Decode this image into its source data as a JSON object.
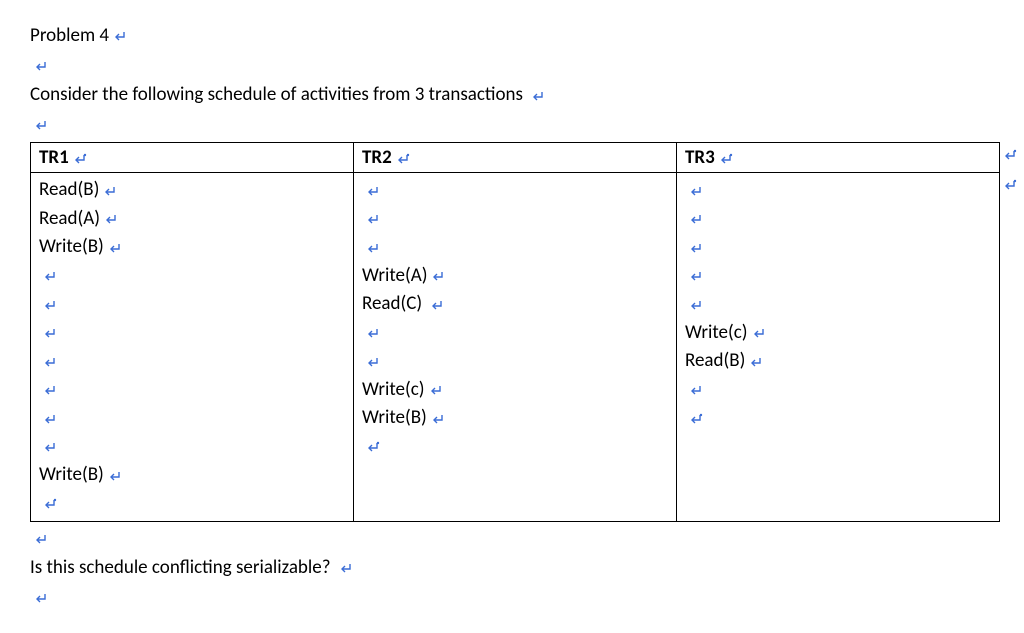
{
  "heading": "Problem 4",
  "intro": "Consider the following schedule of activities from 3 transactions ",
  "question": "Is this schedule conflicting serializable? ",
  "table": {
    "headers": [
      "TR1",
      "TR2",
      "TR3"
    ],
    "rows": [
      {
        "c1": "Read(B)",
        "c2": "",
        "c3": ""
      },
      {
        "c1": "Read(A)",
        "c2": "",
        "c3": ""
      },
      {
        "c1": "Write(B)",
        "c2": "",
        "c3": ""
      },
      {
        "c1": "",
        "c2": "Write(A)",
        "c3": ""
      },
      {
        "c1": "",
        "c2": "Read(C) ",
        "c3": ""
      },
      {
        "c1": "",
        "c2": "",
        "c3": "Write(c)"
      },
      {
        "c1": "",
        "c2": "",
        "c3": "Read(B)"
      },
      {
        "c1": "",
        "c2": "Write(c)",
        "c3": ""
      },
      {
        "c1": "",
        "c2": "Write(B)",
        "c3": ""
      },
      {
        "c1": "",
        "c2": "",
        "c3": null
      },
      {
        "c1": "Write(B)",
        "c2": null,
        "c3": null
      },
      {
        "c1": "",
        "c2": null,
        "c3": null
      }
    ]
  },
  "chart_data": {
    "type": "table",
    "title": "Schedule of activities from 3 transactions",
    "columns": [
      "TR1",
      "TR2",
      "TR3"
    ],
    "rows": [
      [
        "Read(B)",
        "",
        ""
      ],
      [
        "Read(A)",
        "",
        ""
      ],
      [
        "Write(B)",
        "",
        ""
      ],
      [
        "",
        "Write(A)",
        ""
      ],
      [
        "",
        "Read(C)",
        ""
      ],
      [
        "",
        "",
        "Write(c)"
      ],
      [
        "",
        "",
        "Read(B)"
      ],
      [
        "",
        "Write(c)",
        ""
      ],
      [
        "",
        "Write(B)",
        ""
      ],
      [
        "",
        "",
        ""
      ],
      [
        "Write(B)",
        "",
        ""
      ],
      [
        "",
        "",
        ""
      ]
    ]
  }
}
